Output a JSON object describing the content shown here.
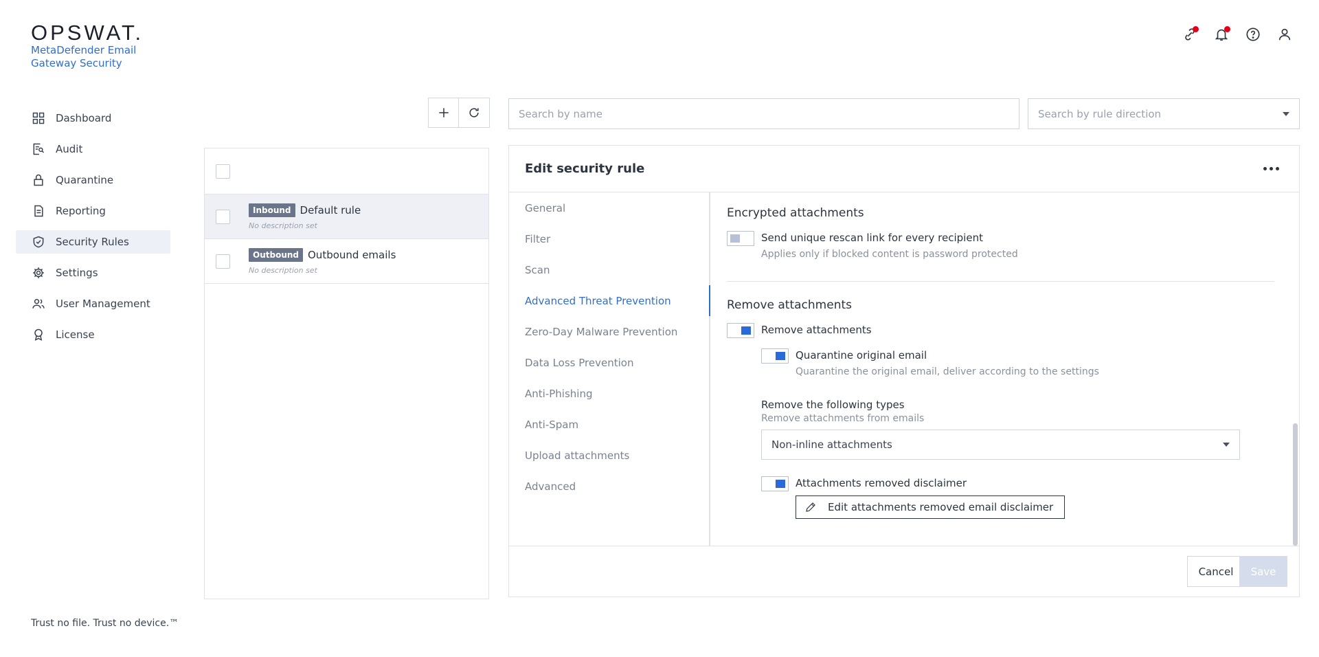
{
  "brand": {
    "logo": "OPSWAT.",
    "product_line1": "MetaDefender Email",
    "product_line2": "Gateway Security",
    "tagline": "Trust no file. Trust no device.™"
  },
  "header_icons": [
    "integration-icon",
    "bell-icon",
    "help-icon",
    "user-icon"
  ],
  "colors": {
    "accent": "#2f6ecf",
    "notification": "#e4001b",
    "badge": "#6a758a",
    "toggle_on": "#2a6ad9"
  },
  "sidebar": {
    "items": [
      {
        "label": "Dashboard",
        "icon": "dashboard-icon"
      },
      {
        "label": "Audit",
        "icon": "audit-icon"
      },
      {
        "label": "Quarantine",
        "icon": "lock-icon"
      },
      {
        "label": "Reporting",
        "icon": "report-icon"
      },
      {
        "label": "Security Rules",
        "icon": "shield-check-icon",
        "active": true
      },
      {
        "label": "Settings",
        "icon": "gear-icon"
      },
      {
        "label": "User Management",
        "icon": "users-icon"
      },
      {
        "label": "License",
        "icon": "award-icon"
      }
    ]
  },
  "rules": [
    {
      "badge": "Inbound",
      "name": "Default rule",
      "desc": "No description set",
      "selected": true
    },
    {
      "badge": "Outbound",
      "name": "Outbound emails",
      "desc": "No description set",
      "selected": false
    }
  ],
  "search": {
    "name_placeholder": "Search by name",
    "direction_placeholder": "Search by rule direction"
  },
  "edit": {
    "title": "Edit security rule",
    "tabs": [
      "General",
      "Filter",
      "Scan",
      "Advanced Threat Prevention",
      "Zero-Day Malware Prevention",
      "Data Loss Prevention",
      "Anti-Phishing",
      "Anti-Spam",
      "Upload attachments",
      "Advanced"
    ],
    "active_tab": "Advanced Threat Prevention",
    "encrypted": {
      "title": "Encrypted attachments",
      "option_label": "Send unique rescan link for every recipient",
      "option_desc": "Applies only if blocked content is password protected"
    },
    "remove": {
      "title": "Remove attachments",
      "option_label": "Remove attachments",
      "quarantine_label": "Quarantine original email",
      "quarantine_desc": "Quarantine the original email, deliver according to the settings",
      "types_label": "Remove the following types",
      "types_desc": "Remove attachments from emails",
      "types_value": "Non-inline attachments",
      "disclaimer_label": "Attachments removed disclaimer",
      "disclaimer_button": "Edit attachments removed email disclaimer"
    },
    "cancel": "Cancel",
    "save": "Save"
  }
}
